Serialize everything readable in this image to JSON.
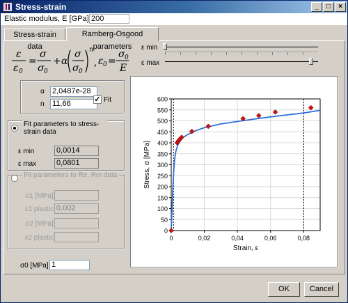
{
  "window": {
    "title": "Stress-strain"
  },
  "title_buttons": {
    "minimize": "_",
    "maximize": "□",
    "close": "×"
  },
  "modulus": {
    "label": "Elastic modulus, E  [GPa]",
    "value": "200"
  },
  "tabs": [
    {
      "label": "Stress-strain data",
      "active": false
    },
    {
      "label": "Ramberg-Osgood parameters",
      "active": true
    }
  ],
  "params": {
    "alpha_label": "α",
    "alpha_value": "2,0487e-28",
    "n_label": "n",
    "n_value": "11,66",
    "fit_label": "Fit",
    "fit_checked": true
  },
  "group1": {
    "title": "Fit parameters to stress-strain data",
    "emin_label": "ε min",
    "emin_value": "0,0014",
    "emax_label": "ε max",
    "emax_value": "0,0801"
  },
  "group2": {
    "title": "Fit parameters to Re, Rm data",
    "sigma1_label": "σ1 [MPa]",
    "sigma1_value": "",
    "eps1_label": "ε1 plastic",
    "eps1_value": "0.002",
    "sigma2_label": "σ2 [MPa]",
    "sigma2_value": "",
    "eps2_label": "ε2 plastic",
    "eps2_value": ""
  },
  "sigma0": {
    "label": "σ0 [MPa]",
    "value": "1"
  },
  "sliders": {
    "emin_label": "ε min",
    "emax_label": "ε max",
    "emin_fraction": 0.0,
    "emax_fraction": 0.98
  },
  "buttons": {
    "ok": "OK",
    "cancel": "Cancel"
  },
  "colors": {
    "curve": "#2f6fd6",
    "points": "#c81414",
    "titlebar": "#0a246a"
  },
  "chart_data": {
    "type": "scatter",
    "xlabel": "Strain, ε",
    "ylabel": "Stress, σ [MPa]",
    "xlim": [
      0,
      0.09
    ],
    "ylim": [
      0,
      600
    ],
    "xticks": [
      0,
      0.02,
      0.04,
      0.06,
      0.08
    ],
    "xtick_labels": [
      "0",
      "0,02",
      "0,04",
      "0,06",
      "0,08"
    ],
    "yticks": [
      0,
      50,
      100,
      150,
      200,
      250,
      300,
      350,
      400,
      450,
      500,
      550,
      600
    ],
    "grid": true,
    "vlines": [
      0.0014,
      0.0801
    ],
    "series": [
      {
        "kind": "points",
        "x": [
          0,
          0.0036,
          0.0043,
          0.005,
          0.0063,
          0.0125,
          0.0224,
          0.0434,
          0.0529,
          0.0629,
          0.0844
        ],
        "y": [
          0,
          400,
          408,
          415,
          425,
          452,
          475,
          510,
          524,
          540,
          560
        ]
      },
      {
        "kind": "line",
        "x": [
          0,
          0.0005,
          0.001,
          0.0015,
          0.002,
          0.0025,
          0.003,
          0.004,
          0.005,
          0.007,
          0.01,
          0.015,
          0.02,
          0.03,
          0.04,
          0.05,
          0.06,
          0.07,
          0.08,
          0.09
        ],
        "y": [
          0,
          100,
          198,
          270,
          320,
          348,
          366,
          390,
          404,
          423,
          438,
          456,
          469,
          486,
          497,
          508,
          518,
          527,
          536,
          548
        ]
      }
    ]
  }
}
